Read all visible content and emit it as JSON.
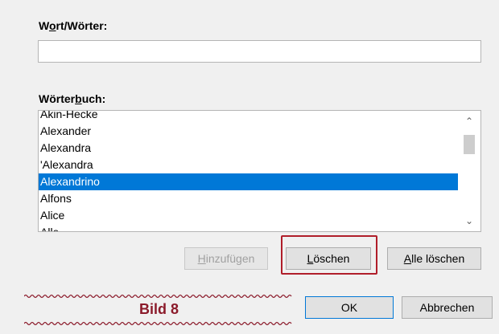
{
  "word_field": {
    "label_pre": "W",
    "label_under": "o",
    "label_post": "rt/Wörter:",
    "value": "",
    "placeholder": ""
  },
  "dictionary": {
    "label_pre": "Wörter",
    "label_under": "b",
    "label_post": "uch:",
    "items": [
      "Akin-Hecke",
      "Alexander",
      "Alexandra",
      "'Alexandra",
      "Alexandrino",
      "Alfons",
      "Alice",
      "Alle"
    ],
    "selected_index": 4
  },
  "buttons": {
    "add": {
      "pre": "",
      "under": "H",
      "post": "inzufügen"
    },
    "delete": {
      "pre": "",
      "under": "L",
      "post": "öschen"
    },
    "delete_all": {
      "pre": "",
      "under": "A",
      "post": "lle löschen"
    },
    "ok": "OK",
    "cancel": "Abbrechen"
  },
  "caption": "Bild 8",
  "icons": {
    "scroll_up": "chevron-up-icon",
    "scroll_down": "chevron-down-icon"
  },
  "colors": {
    "selection": "#0078d7",
    "highlight": "#b01e2a",
    "caption": "#8b1a2a"
  }
}
